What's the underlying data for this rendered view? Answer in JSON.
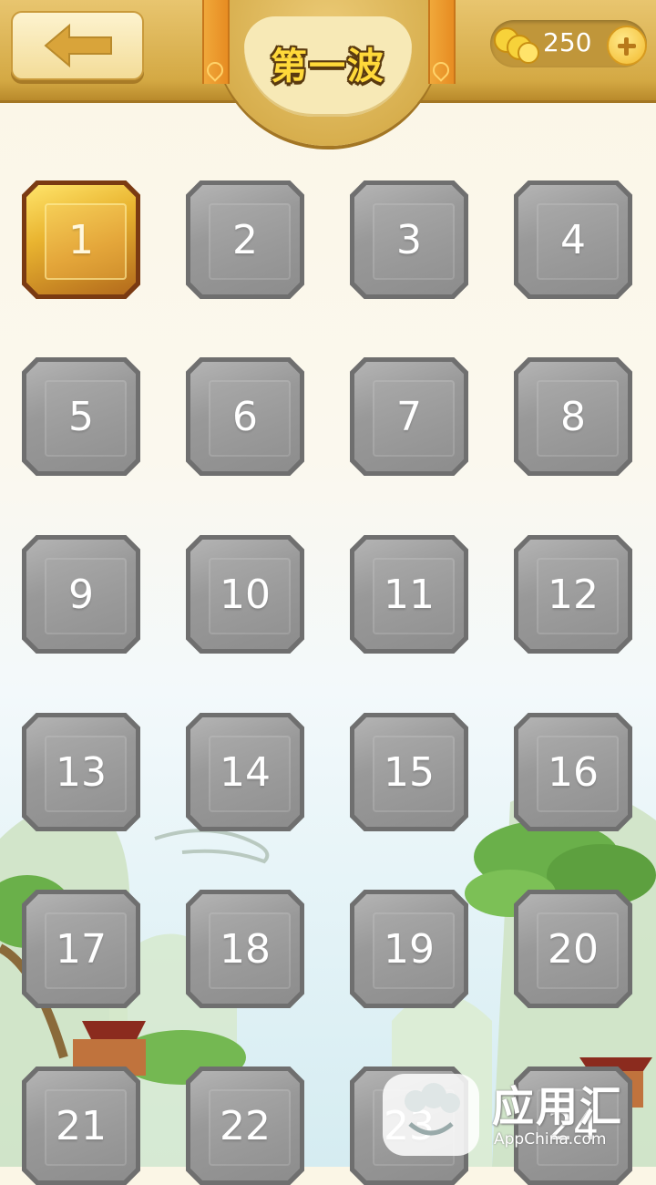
{
  "header": {
    "back_icon": "left-arrow-icon",
    "title": "第一波",
    "coins": "250",
    "coin_icon": "coins-icon",
    "add_icon": "plus-icon"
  },
  "levels": [
    {
      "label": "1",
      "state": "unlocked"
    },
    {
      "label": "2",
      "state": "locked"
    },
    {
      "label": "3",
      "state": "locked"
    },
    {
      "label": "4",
      "state": "locked"
    },
    {
      "label": "5",
      "state": "locked"
    },
    {
      "label": "6",
      "state": "locked"
    },
    {
      "label": "7",
      "state": "locked"
    },
    {
      "label": "8",
      "state": "locked"
    },
    {
      "label": "9",
      "state": "locked"
    },
    {
      "label": "10",
      "state": "locked"
    },
    {
      "label": "11",
      "state": "locked"
    },
    {
      "label": "12",
      "state": "locked"
    },
    {
      "label": "13",
      "state": "locked"
    },
    {
      "label": "14",
      "state": "locked"
    },
    {
      "label": "15",
      "state": "locked"
    },
    {
      "label": "16",
      "state": "locked"
    },
    {
      "label": "17",
      "state": "locked"
    },
    {
      "label": "18",
      "state": "locked"
    },
    {
      "label": "19",
      "state": "locked"
    },
    {
      "label": "20",
      "state": "locked"
    },
    {
      "label": "21",
      "state": "locked"
    },
    {
      "label": "22",
      "state": "locked"
    },
    {
      "label": "23",
      "state": "locked"
    },
    {
      "label": "24",
      "state": "locked"
    }
  ],
  "watermark": {
    "text": "应用汇",
    "subtext": "AppChina.com"
  },
  "colors": {
    "header_gold": "#d4a944",
    "tile_gray": "#9a9a9a",
    "tile_gold": "#e9b430"
  }
}
